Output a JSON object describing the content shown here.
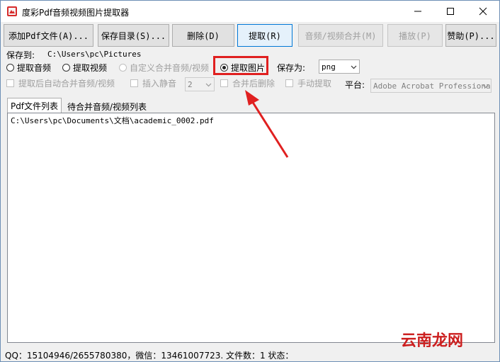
{
  "window": {
    "title": "度彩Pdf音频视频图片提取器",
    "controls": {
      "minimize": "minimize",
      "maximize": "maximize",
      "close": "close"
    }
  },
  "toolbar": {
    "add_pdf": "添加Pdf文件(A)...",
    "save_dir": "保存目录(S)...",
    "delete": "删除(D)",
    "extract": "提取(R)",
    "merge_av": "音频/视频合并(M)",
    "play": "播放(P)",
    "donate": "赞助(P)..."
  },
  "options": {
    "save_to_label": "保存到:",
    "save_to_path": "C:\\Users\\pc\\Pictures",
    "extract_audio": "提取音频",
    "extract_video": "提取视频",
    "custom_merge": "自定义合并音频/视频",
    "extract_image": "提取图片",
    "save_as_label": "保存为:",
    "save_as_value": "png",
    "auto_merge": "提取后自动合并音频/视频",
    "insert_silence": "插入静音",
    "silence_value": "2",
    "delete_after_merge": "合并后删除",
    "manual_extract": "手动提取",
    "platform_label": "平台:",
    "platform_value": "Adobe Acrobat Professional"
  },
  "tabs": [
    {
      "label": "Pdf文件列表"
    },
    {
      "label": "待合并音频/视频列表"
    }
  ],
  "file_list": [
    "C:\\Users\\pc\\Documents\\文档\\academic_0002.pdf"
  ],
  "status": "QQ：15104946/2655780380，微信：13461007723.  文件数：1   状态：",
  "watermark": "云南龙网",
  "colors": {
    "highlight": "#e02020",
    "accent": "#0078d7"
  }
}
